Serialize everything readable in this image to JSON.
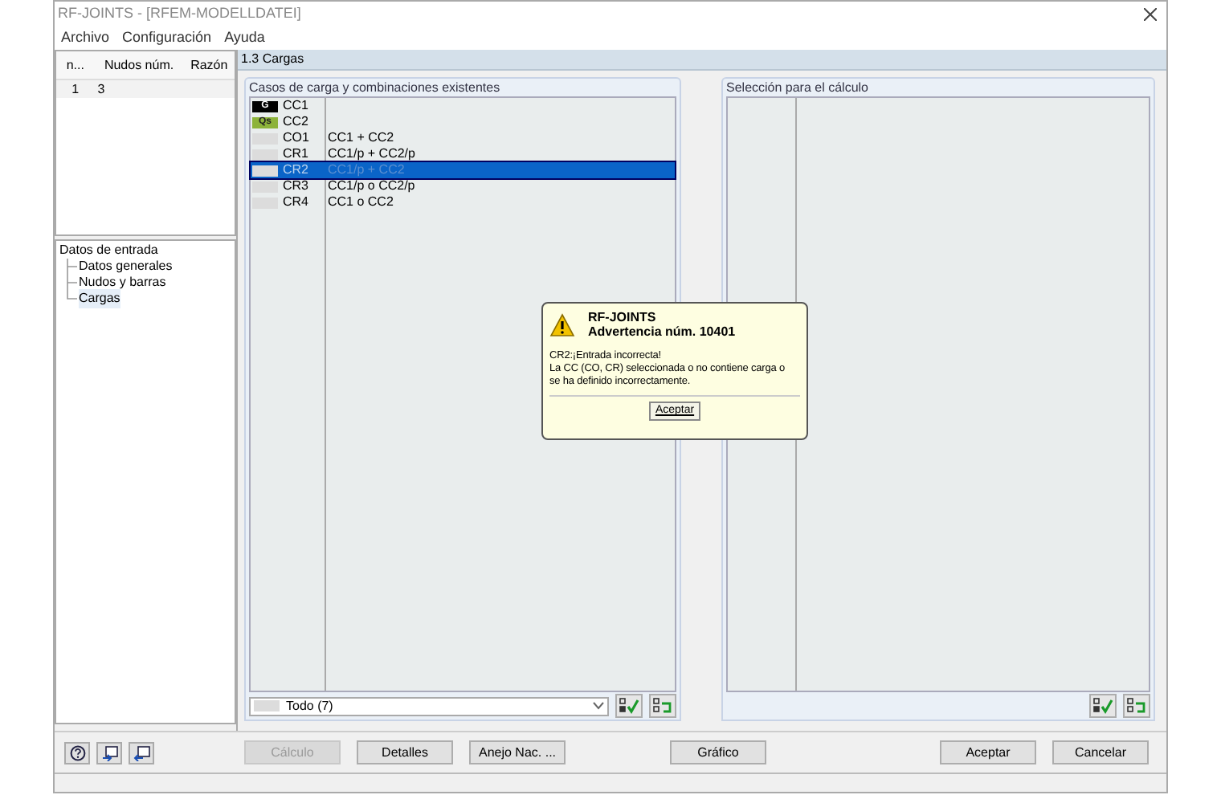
{
  "window": {
    "title": "RF-JOINTS - [RFEM-MODELLDATEI]"
  },
  "menu": [
    "Archivo",
    "Configuración",
    "Ayuda"
  ],
  "left_table": {
    "columns": [
      "n...",
      "Nudos núm.",
      "Razón"
    ],
    "rows": [
      [
        "1",
        "3",
        ""
      ]
    ]
  },
  "nav_tree": {
    "label": "Datos de entrada",
    "children": [
      {
        "label": "Datos generales",
        "selected": false
      },
      {
        "label": "Nudos y barras",
        "selected": false
      },
      {
        "label": "Cargas",
        "selected": true
      }
    ]
  },
  "section_title": "1.3 Cargas",
  "existing": {
    "title": "Casos de carga y combinaciones existentes",
    "rows": [
      {
        "tag": "G",
        "color": "#000000",
        "name": "CC1",
        "description": "",
        "selected": false
      },
      {
        "tag": "Qs",
        "color": "#8db33a",
        "name": "CC2",
        "description": "",
        "selected": false
      },
      {
        "tag": "",
        "color": "#dcdcdc",
        "name": "CO1",
        "description": "CC1 + CC2",
        "selected": false
      },
      {
        "tag": "",
        "color": "#dcdcdc",
        "name": "CR1",
        "description": "CC1/p + CC2/p",
        "selected": false
      },
      {
        "tag": "",
        "color": "#dcdcdc",
        "name": "CR2",
        "description": "CC1/p + CC2",
        "selected": true
      },
      {
        "tag": "",
        "color": "#dcdcdc",
        "name": "CR3",
        "description": "CC1/p o CC2/p",
        "selected": false
      },
      {
        "tag": "",
        "color": "#dcdcdc",
        "name": "CR4",
        "description": "CC1 o CC2",
        "selected": false
      }
    ],
    "filter": "Todo (7)"
  },
  "selection": {
    "title": "Selección para el cálculo"
  },
  "dialog": {
    "title": "RF-JOINTS",
    "subtitle": "Advertencia núm. 10401",
    "message_lines": [
      "CR2:¡Entrada incorrecta!",
      "La CC (CO, CR) seleccionada o no contiene carga o",
      "se ha definido incorrectamente."
    ],
    "button": "Aceptar"
  },
  "bottom_buttons": [
    {
      "label": "Cálculo",
      "disabled": true
    },
    {
      "label": "Detalles",
      "disabled": false
    },
    {
      "label": "Anejo Nac. ...",
      "disabled": false
    },
    {
      "label": "Gráfico",
      "disabled": false
    },
    {
      "label": "Aceptar",
      "disabled": false
    },
    {
      "label": "Cancelar",
      "disabled": false
    }
  ]
}
